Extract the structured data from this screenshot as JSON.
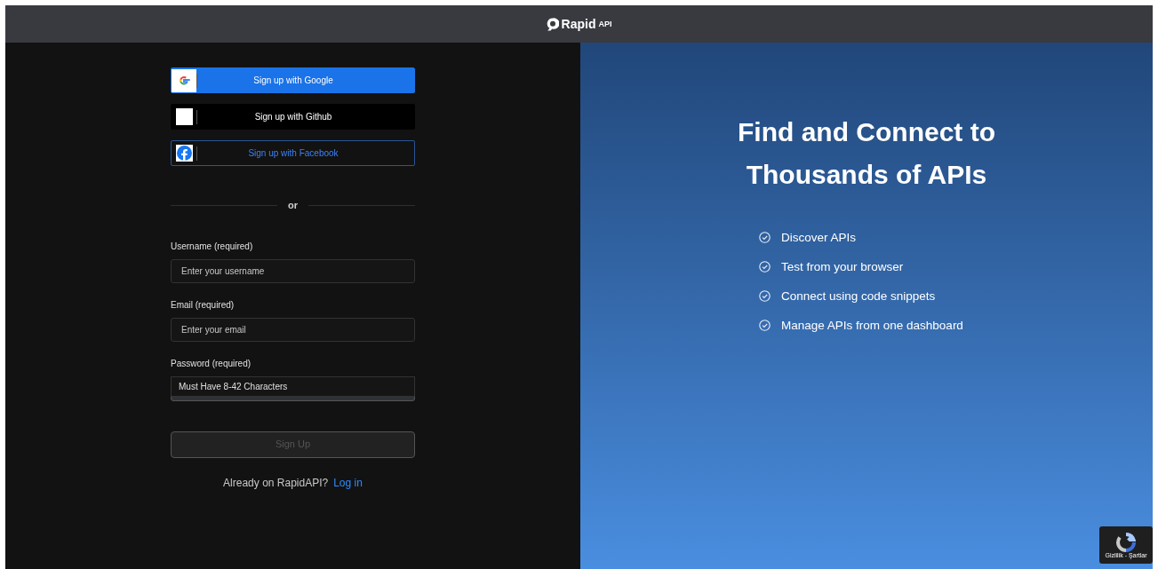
{
  "header": {
    "logo_word": "Rapid",
    "logo_suffix": "API"
  },
  "social_buttons": [
    {
      "kind": "google",
      "label": "Sign up with Google"
    },
    {
      "kind": "github",
      "label": "Sign up with Github"
    },
    {
      "kind": "facebook",
      "label": "Sign up with Facebook"
    }
  ],
  "divider": "or",
  "fields": [
    {
      "label": "Username (required)",
      "placeholder": "Enter your username"
    },
    {
      "label": "Email (required)",
      "placeholder": "Enter your email"
    },
    {
      "label": "Password (required)",
      "hint": "Must Have 8-42 Characters"
    }
  ],
  "submit": {
    "label": "Sign Up",
    "disabled": true
  },
  "login_prompt": {
    "text": "Already on RapidAPI?",
    "link": "Log in"
  },
  "promo": {
    "title_lines": [
      "Find and Connect to",
      "Thousands of APIs"
    ],
    "features": [
      "Discover APIs",
      "Test from your browser",
      "Connect using code snippets",
      "Manage APIs from one dashboard"
    ]
  },
  "recaptcha": {
    "text": "Gizlilik - Şartlar"
  }
}
